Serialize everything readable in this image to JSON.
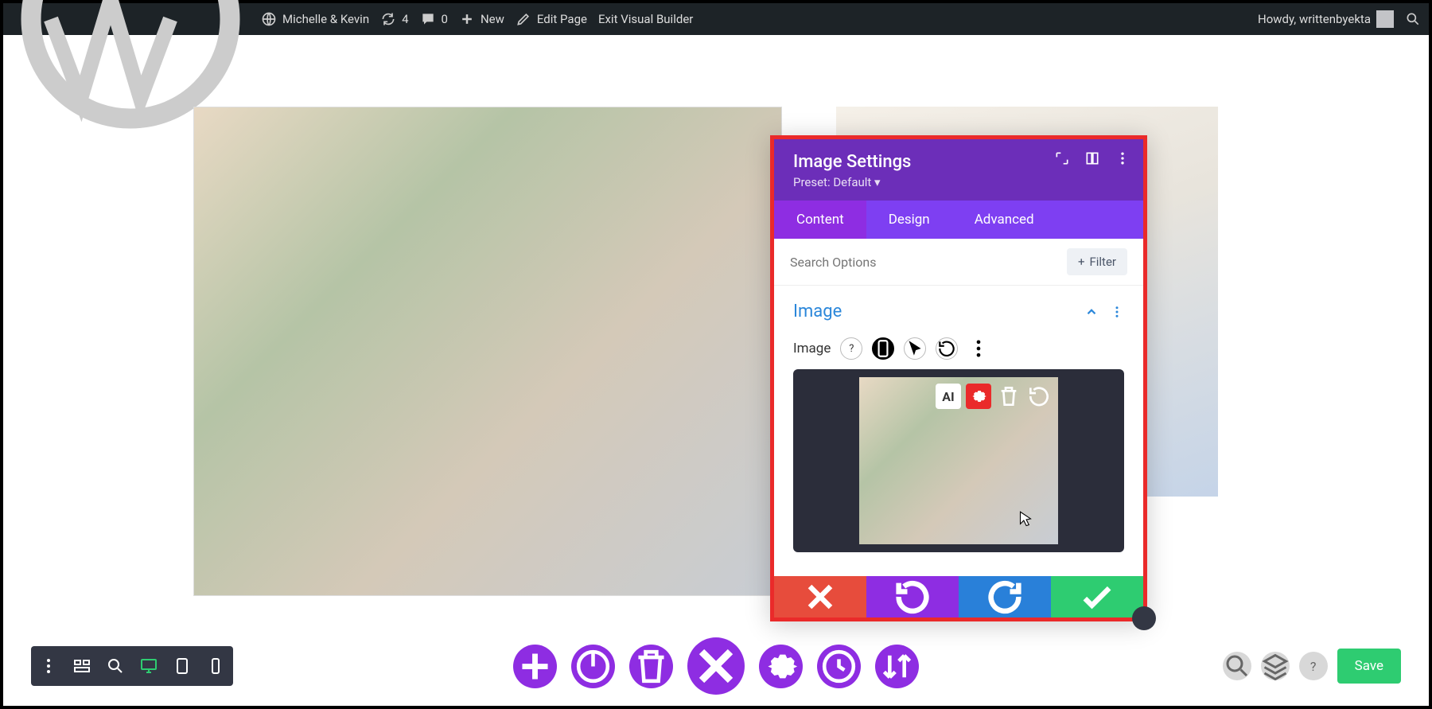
{
  "adminbar": {
    "site_name": "Michelle & Kevin",
    "updates_count": "4",
    "comments_count": "0",
    "new_label": "New",
    "edit_page_label": "Edit Page",
    "exit_vb_label": "Exit Visual Builder",
    "greeting": "Howdy, writtenbyekta"
  },
  "panel": {
    "title": "Image Settings",
    "preset_label": "Preset: Default",
    "tabs": {
      "content": "Content",
      "design": "Design",
      "advanced": "Advanced"
    },
    "search_placeholder": "Search Options",
    "filter_label": "Filter",
    "section_title": "Image",
    "field_label": "Image"
  },
  "bottom": {
    "save_label": "Save"
  }
}
